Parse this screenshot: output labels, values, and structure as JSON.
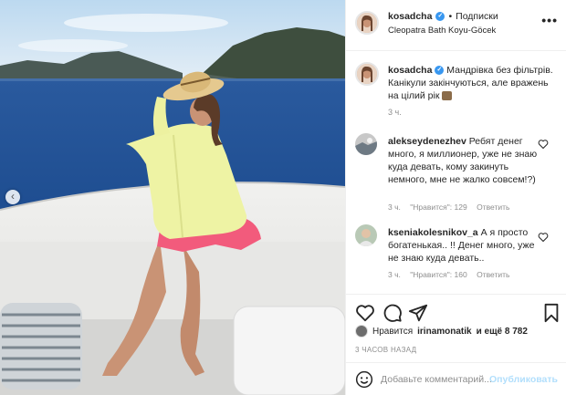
{
  "post": {
    "username": "kosadcha",
    "separator": "•",
    "follow_label": "Подписки",
    "location": "Cleopatra Bath Koyu-Göcek",
    "more_label": "•••"
  },
  "caption": {
    "username": "kosadcha",
    "text": "Мандрівка без фільтрів. Канікули закінчуються, але вражень на цілий рік",
    "time": "3 ч."
  },
  "comments": [
    {
      "username": "alekseydenezhev",
      "text": "Ребят денег много, я миллионер, уже не знаю куда девать, кому закинуть немного, мне не жалко совсем!?)",
      "time": "3 ч.",
      "likes": "\"Нравится\": 129",
      "reply": "Ответить"
    },
    {
      "username": "kseniakolesnikov_a",
      "text": "А я просто богатенькая.. !! Денег много, уже не знаю куда девать..",
      "time": "3 ч.",
      "likes": "\"Нравится\": 160",
      "reply": "Ответить"
    }
  ],
  "likes": {
    "prefix": "Нравится",
    "liker": "irinamonatik",
    "suffix": "и ещё 8 782"
  },
  "post_time": "3 ЧАСОВ НАЗАД",
  "add_comment": {
    "placeholder": "Добавьте комментарий...",
    "publish_label": "Опубликовать"
  },
  "colors": {
    "link": "#3897f0",
    "publish_disabled": "#b2dffc",
    "muted": "#8e8e8e"
  },
  "icons": [
    "verified-badge-icon",
    "more-icon",
    "heart-icon",
    "comment-icon",
    "share-icon",
    "bookmark-icon",
    "smile-icon",
    "carousel-left-icon"
  ]
}
